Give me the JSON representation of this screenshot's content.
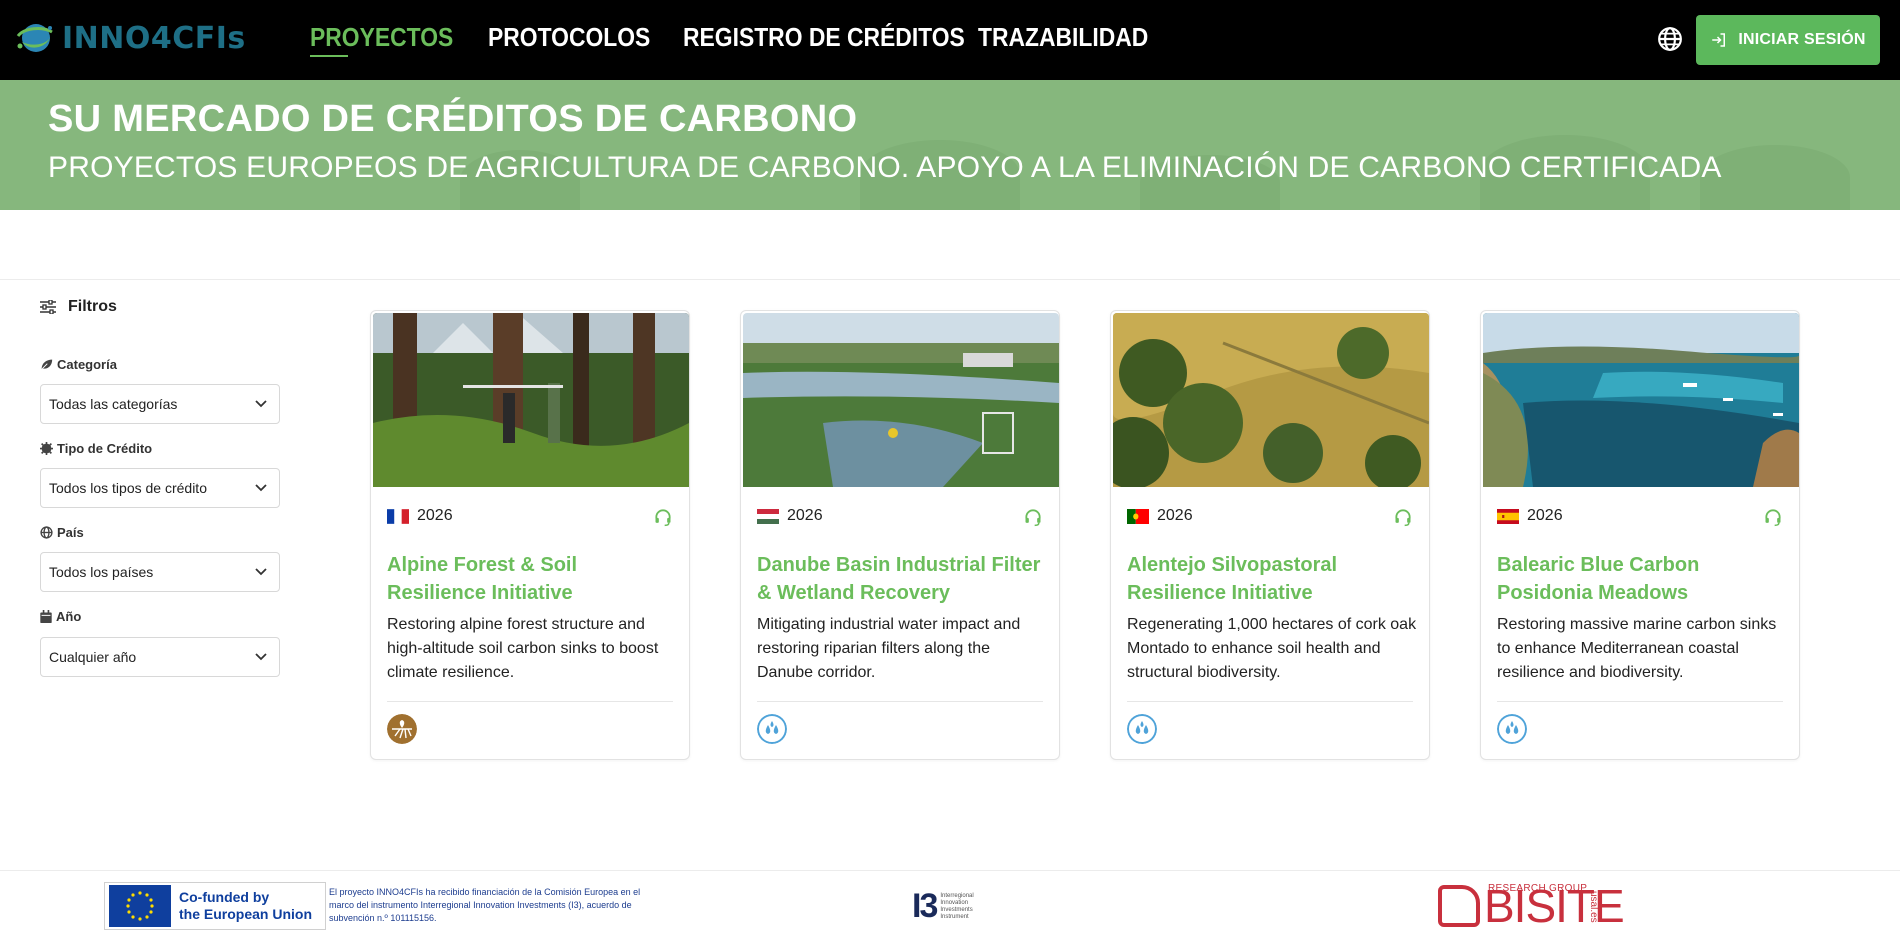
{
  "header": {
    "logo_text": "INNO4CFIs",
    "nav": [
      {
        "label": "PROYECTOS",
        "active": true
      },
      {
        "label": "PROTOCOLOS",
        "active": false
      },
      {
        "label": "REGISTRO DE CRÉDITOS",
        "active": false
      },
      {
        "label": "TRAZABILIDAD",
        "active": false
      }
    ],
    "language_icon": "globe-icon",
    "login_label": "INICIAR SESIÓN",
    "login_icon": "sign-in-icon",
    "accent_color": "#5cb85c"
  },
  "hero": {
    "title": "SU MERCADO DE CRÉDITOS DE CARBONO",
    "subtitle": "PROYECTOS EUROPEOS DE AGRICULTURA DE CARBONO. APOYO A LA ELIMINACIÓN DE CARBONO CERTIFICADA",
    "background_color": "#86b77d"
  },
  "filters": {
    "title": "Filtros",
    "groups": [
      {
        "label": "Categoría",
        "icon": "leaf-icon",
        "selected": "Todas las categorías"
      },
      {
        "label": "Tipo de Crédito",
        "icon": "seal-icon",
        "selected": "Todos los tipos de crédito"
      },
      {
        "label": "País",
        "icon": "globe-icon",
        "selected": "Todos los países"
      },
      {
        "label": "Año",
        "icon": "calendar-icon",
        "selected": "Cualquier año"
      }
    ]
  },
  "projects": [
    {
      "flag": "France",
      "year": "2026",
      "title": "Alpine Forest & Soil Resilience Initiative",
      "description": "Restoring alpine forest structure and high-altitude soil carbon sinks to boost climate resilience.",
      "category_icon": "soil-icon"
    },
    {
      "flag": "Hungary",
      "year": "2026",
      "title": "Danube Basin Industrial Filter & Wetland Recovery",
      "description": "Mitigating industrial water impact and restoring riparian filters along the Danube corridor.",
      "category_icon": "water-drops-icon"
    },
    {
      "flag": "Portugal",
      "year": "2026",
      "title": "Alentejo Silvopastoral Resilience Initiative",
      "description": "Regenerating 1,000 hectares of cork oak Montado to enhance soil health and structural biodiversity.",
      "category_icon": "water-drops-icon"
    },
    {
      "flag": "Spain",
      "year": "2026",
      "title": "Balearic Blue Carbon Posidonia Meadows",
      "description": "Restoring massive marine carbon sinks to enhance Mediterranean coastal resilience and biodiversity.",
      "category_icon": "water-drops-icon"
    }
  ],
  "footer": {
    "eu_label": "Co-funded by the European Union",
    "eu_line1": "Co-funded by",
    "eu_line2": "the European Union",
    "funding_note": "El proyecto INNO4CFIs ha recibido financiación de la Comisión Europea en el marco del instrumento Interregional Innovation Investments (I3), acuerdo de subvención n.º 101115156.",
    "i3_mark": "I3",
    "i3_text": "Interregional Innovation Investments Instrument",
    "bisite_word": "BISITE",
    "bisite_rg": "RESEARCH GROUP",
    "bisite_usal": "usal.es"
  }
}
